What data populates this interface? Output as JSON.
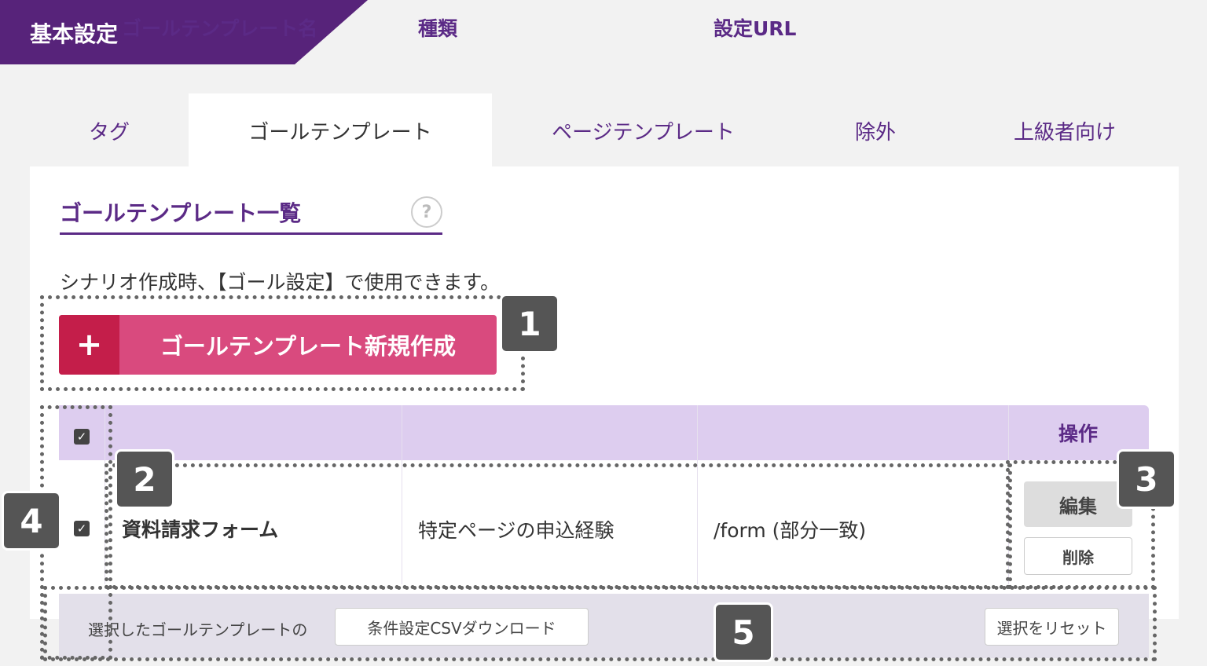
{
  "header": {
    "title": "基本設定"
  },
  "tabs": [
    {
      "label": "タグ",
      "active": false
    },
    {
      "label": "ゴールテンプレート",
      "active": true
    },
    {
      "label": "ページテンプレート",
      "active": false
    },
    {
      "label": "除外",
      "active": false
    },
    {
      "label": "上級者向け",
      "active": false
    }
  ],
  "section": {
    "title": "ゴールテンプレート一覧",
    "help": "?",
    "description": "シナリオ作成時、【ゴール設定】で使用できます。"
  },
  "create_button": {
    "icon": "+",
    "label": "ゴールテンプレート新規作成"
  },
  "table": {
    "headers": [
      "ゴールテンプレート名",
      "種類",
      "設定URL",
      "操作"
    ],
    "rows": [
      {
        "name": "資料請求フォーム",
        "type": "特定ページの申込経験",
        "url": "/form (部分一致)",
        "checked": true
      }
    ],
    "edit_label": "編集",
    "delete_label": "削除"
  },
  "footer": {
    "text": "選択したゴールテンプレートの",
    "csv_label": "条件設定CSVダウンロード",
    "reset_label": "選択をリセット"
  },
  "badges": [
    "1",
    "2",
    "3",
    "4",
    "5"
  ],
  "colors": {
    "primary": "#57237a",
    "accent": "#d94a7e",
    "accent_dark": "#c41e4a",
    "table_header": "#ddcdef"
  }
}
